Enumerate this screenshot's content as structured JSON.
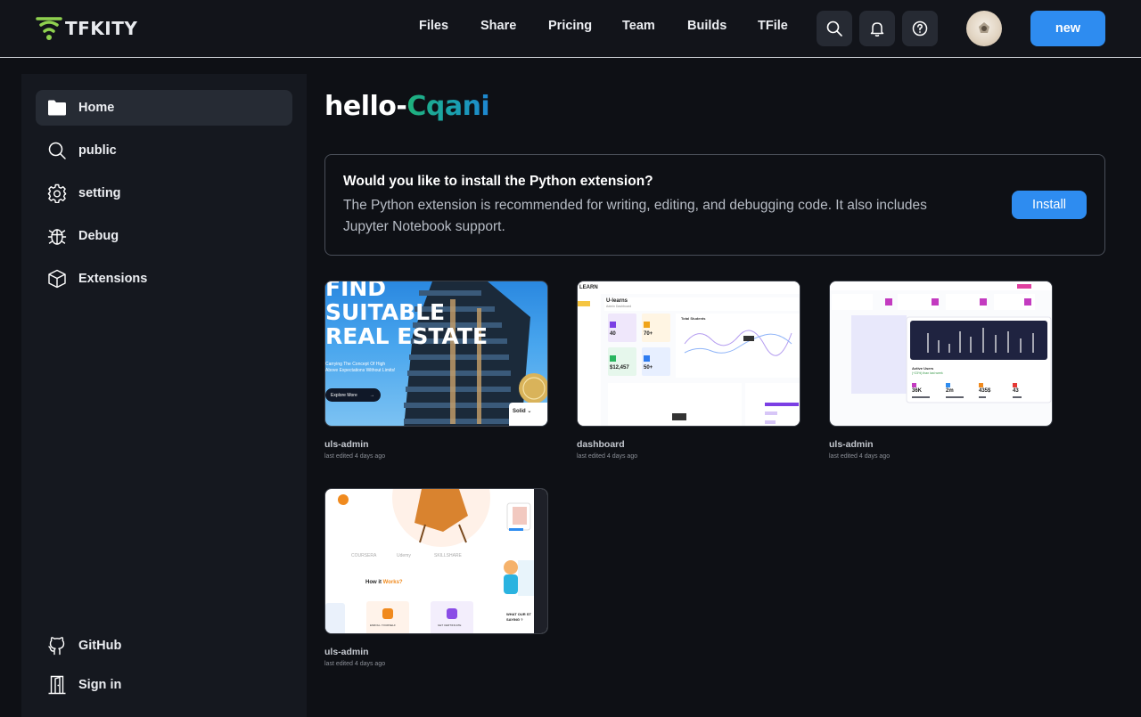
{
  "header": {
    "logo_text": "TFKITY",
    "nav": [
      "Files",
      "Share",
      "Pricing",
      "Team",
      "Builds",
      "TFile"
    ],
    "new_label": "new"
  },
  "sidebar": {
    "items": [
      {
        "label": "Home",
        "icon": "folder-icon",
        "active": true
      },
      {
        "label": "public",
        "icon": "search-icon"
      },
      {
        "label": "setting",
        "icon": "gear-icon"
      },
      {
        "label": "Debug",
        "icon": "bug-icon"
      },
      {
        "label": "Extensions",
        "icon": "cube-icon"
      }
    ],
    "bottom": [
      {
        "label": "GitHub",
        "icon": "github-icon"
      },
      {
        "label": "Sign in",
        "icon": "door-icon"
      }
    ]
  },
  "main": {
    "title_prefix": "hello-",
    "title_name": "Cqani",
    "banner": {
      "title": "Would you like to install the Python extension?",
      "body": "The Python extension is recommended for writing, editing, and debugging code. It also includes Jupyter Notebook support.",
      "button": "Install"
    },
    "projects": [
      {
        "name": "uls-admin",
        "meta": "last edited 4 days ago",
        "thumb": {
          "lines": [
            "FIND",
            "SUITABLE",
            "REAL ESTATE"
          ],
          "sub1": "Carrying The Concept Of High",
          "sub2": "Above Expectations Without Limits!",
          "button": "Explore More",
          "badge": "Solid"
        }
      },
      {
        "name": "dashboard",
        "meta": "last edited 4 days ago",
        "thumb": {
          "brand": "LEARN",
          "heading": "U-learns",
          "sub": "Admin Dashboard",
          "chart_title": "Total Students",
          "stats": [
            "40",
            "70+",
            "$12,457",
            "50+"
          ]
        }
      },
      {
        "name": "uls-admin",
        "meta": "last edited 4 days ago",
        "thumb": {
          "panel_title": "Active Users",
          "panel_sub": "(+23%) than last week",
          "stats": [
            "36K",
            "2m",
            "435$",
            "43"
          ]
        }
      },
      {
        "name": "uls-admin",
        "meta": "last edited 4 days ago",
        "thumb": {
          "logos": [
            "COURSERA",
            "Udemy",
            "SKILLSHARE"
          ],
          "how_prefix": "How it ",
          "how_accent": "Works?",
          "step1": "ENROLL YOURSELF",
          "step2": "GET CERTIFICATE",
          "side_text": "WHAT OUR ST\nSAYING ?"
        }
      }
    ]
  },
  "colors": {
    "accent": "#2e8cf0",
    "logo_green": "#8fd14f",
    "title_gradient_start": "#1fb27a",
    "title_gradient_end": "#1e86d2"
  }
}
